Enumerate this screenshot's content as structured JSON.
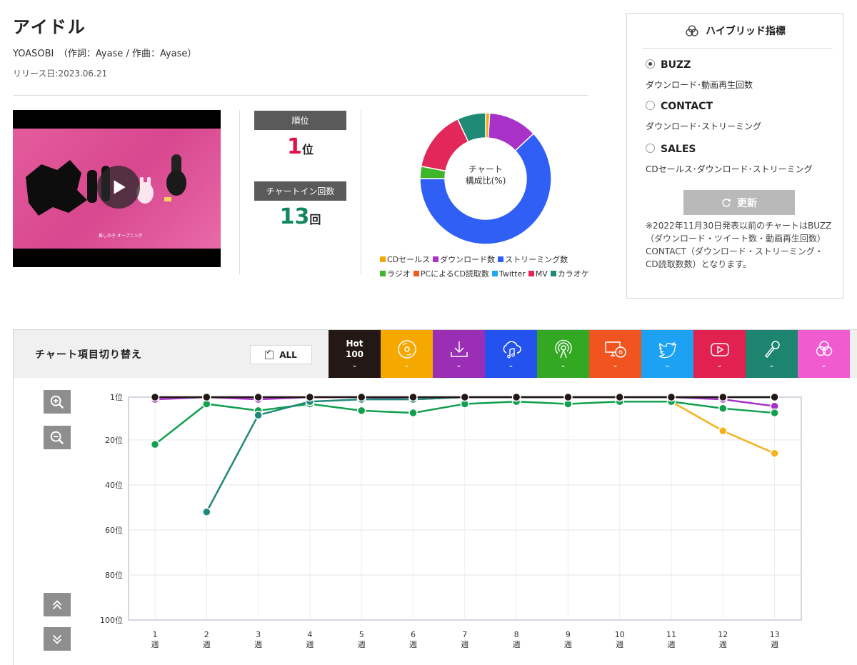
{
  "song": {
    "title": "アイドル",
    "artist_line": "YOASOBI　（作詞：Ayase / 作曲：Ayase）",
    "release": "リリース日:2023.06.21"
  },
  "stats": {
    "rank_label": "順位",
    "rank_value": "1",
    "rank_unit": "位",
    "chartin_label": "チャートイン回数",
    "chartin_value": "13",
    "chartin_unit": "回"
  },
  "donut": {
    "center_line1": "チャート",
    "center_line2": "構成比(%)"
  },
  "donut_legend": [
    {
      "label": "CDセールス",
      "color": "#f5a800"
    },
    {
      "label": "ダウンロード数",
      "color": "#a832c8"
    },
    {
      "label": "ストリーミング数",
      "color": "#2f5ff5"
    },
    {
      "label": "ラジオ",
      "color": "#3fb529"
    },
    {
      "label": "PCによるCD読取数",
      "color": "#f25a1d"
    },
    {
      "label": "Twitter",
      "color": "#1ea6f0"
    },
    {
      "label": "MV",
      "color": "#e3275a"
    },
    {
      "label": "カラオケ",
      "color": "#1f8a76"
    }
  ],
  "hybrid": {
    "title": "ハイブリッド指標",
    "options": [
      {
        "label": "BUZZ",
        "desc": "ダウンロード･動画再生回数",
        "selected": true
      },
      {
        "label": "CONTACT",
        "desc": "ダウンロード･ストリーミング",
        "selected": false
      },
      {
        "label": "SALES",
        "desc": "CDセールス･ダウンロード･ストリーミング",
        "selected": false
      }
    ],
    "refresh_label": "更新",
    "note": "※2022年11月30日発表以前のチャートはBUZZ（ダウンロード・ツイート数・動画再生回数）CONTACT（ダウンロード・ストリーミング・CD読取数数）となります。"
  },
  "panel": {
    "title": "チャート項目切り替え",
    "all_label": "ALL",
    "hot_line1": "Hot",
    "hot_line2": "100",
    "tabs": [
      {
        "icon": "hot100-icon",
        "color": "#231815"
      },
      {
        "icon": "cd-icon",
        "color": "#f5a800"
      },
      {
        "icon": "download-icon",
        "color": "#9a2fb5"
      },
      {
        "icon": "streaming-icon",
        "color": "#2352ef"
      },
      {
        "icon": "radio-icon",
        "color": "#33a823"
      },
      {
        "icon": "pc-cd-icon",
        "color": "#f2541f"
      },
      {
        "icon": "twitter-icon",
        "color": "#1da1f2"
      },
      {
        "icon": "youtube-icon",
        "color": "#e32151"
      },
      {
        "icon": "karaoke-icon",
        "color": "#1d8470"
      },
      {
        "icon": "hybrid-icon",
        "color": "#f05ccf"
      }
    ]
  },
  "chart_data": [
    {
      "type": "pie",
      "title": "チャート 構成比(%)",
      "categories": [
        "CDセールス",
        "ダウンロード数",
        "ストリーミング数",
        "ラジオ",
        "PCによるCD読取数",
        "Twitter",
        "MV",
        "カラオケ"
      ],
      "values": [
        1,
        12,
        62,
        3,
        0,
        0,
        15,
        7
      ]
    },
    {
      "type": "line",
      "x": [
        "1週",
        "2週",
        "3週",
        "4週",
        "5週",
        "6週",
        "7週",
        "8週",
        "9週",
        "10週",
        "11週",
        "12週",
        "13週"
      ],
      "x_numbers": [
        "1",
        "2",
        "3",
        "4",
        "5",
        "6",
        "7",
        "8",
        "9",
        "10",
        "11",
        "12",
        "13"
      ],
      "x_unit": "週",
      "yticks": [
        "1位",
        "20位",
        "40位",
        "60位",
        "80位",
        "100位"
      ],
      "ylim": [
        1,
        100
      ],
      "y_reversed": true,
      "grid": true,
      "series": [
        {
          "key": "cd",
          "color": "#f5b21e",
          "values": [
            null,
            null,
            null,
            null,
            null,
            null,
            null,
            null,
            null,
            null,
            3,
            16,
            26
          ]
        },
        {
          "key": "download",
          "color": "#a832c8",
          "values": [
            2,
            1,
            2,
            1,
            1,
            2,
            1,
            1,
            1,
            1,
            1,
            2,
            5
          ]
        },
        {
          "key": "radio",
          "color": "#12a04f",
          "values": [
            22,
            4,
            7,
            4,
            7,
            8,
            4,
            3,
            4,
            3,
            3,
            6,
            8
          ]
        },
        {
          "key": "karaoke",
          "color": "#1f8a76",
          "values": [
            null,
            52,
            9,
            3,
            2,
            2,
            1,
            1,
            1,
            1,
            1,
            1,
            1
          ]
        },
        {
          "key": "hot100",
          "color": "#231815",
          "values": [
            1,
            1,
            1,
            1,
            1,
            1,
            1,
            1,
            1,
            1,
            1,
            1,
            1
          ]
        }
      ]
    }
  ]
}
